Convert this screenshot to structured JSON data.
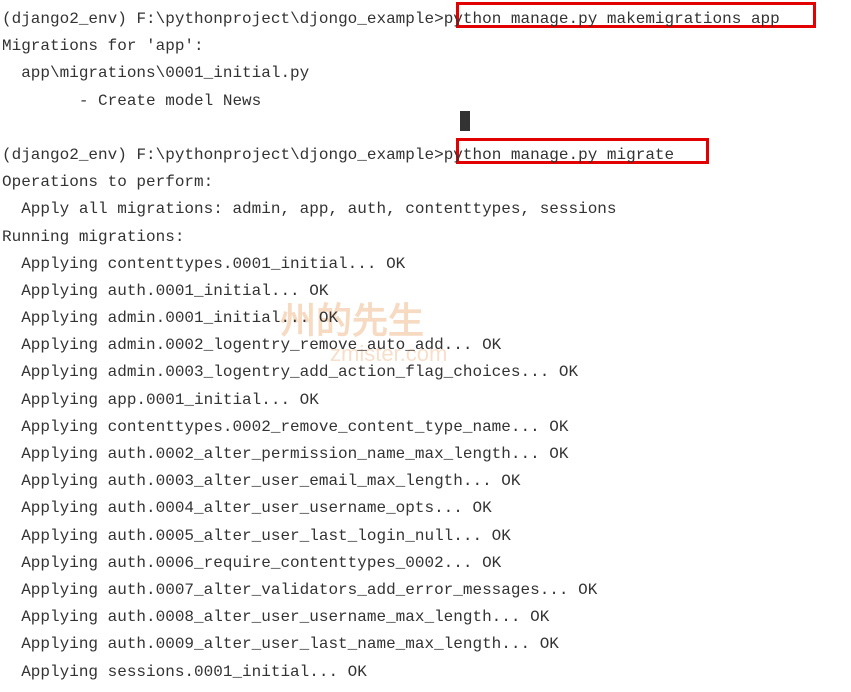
{
  "prompt1": {
    "env": "(django2_env)",
    "path": "F:\\pythonproject\\djongo_example>",
    "command": "python manage.py makemigrations app"
  },
  "migrations_header": "Migrations for 'app':",
  "migration_file": "  app\\migrations\\0001_initial.py",
  "migration_action": "        - Create model News",
  "prompt2": {
    "env": "(django2_env)",
    "path": "F:\\pythonproject\\djongo_example>",
    "command": "python manage.py migrate"
  },
  "operations_header": "Operations to perform:",
  "apply_all": "  Apply all migrations: admin, app, auth, contenttypes, sessions",
  "running_header": "Running migrations:",
  "migrations": [
    "  Applying contenttypes.0001_initial... OK",
    "  Applying auth.0001_initial... OK",
    "  Applying admin.0001_initial... OK",
    "  Applying admin.0002_logentry_remove_auto_add... OK",
    "  Applying admin.0003_logentry_add_action_flag_choices... OK",
    "  Applying app.0001_initial... OK",
    "  Applying contenttypes.0002_remove_content_type_name... OK",
    "  Applying auth.0002_alter_permission_name_max_length... OK",
    "  Applying auth.0003_alter_user_email_max_length... OK",
    "  Applying auth.0004_alter_user_username_opts... OK",
    "  Applying auth.0005_alter_user_last_login_null... OK",
    "  Applying auth.0006_require_contenttypes_0002... OK",
    "  Applying auth.0007_alter_validators_add_error_messages... OK",
    "  Applying auth.0008_alter_user_username_max_length... OK",
    "  Applying auth.0009_alter_user_last_name_max_length... OK",
    "  Applying sessions.0001_initial... OK"
  ],
  "watermark": {
    "main": "州的先生",
    "sub": "zmister.com"
  }
}
